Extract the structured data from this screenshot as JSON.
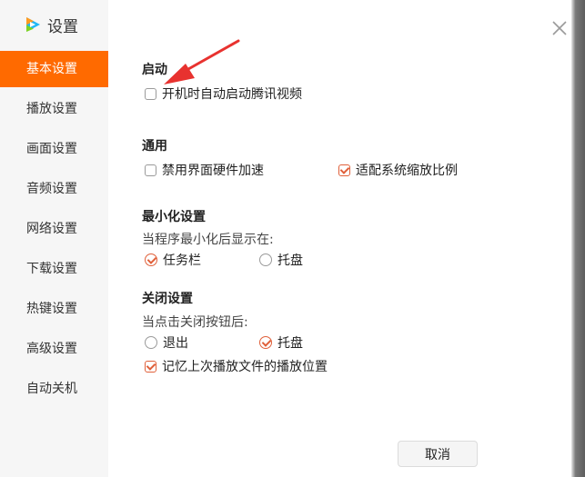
{
  "window": {
    "title": "设置"
  },
  "sidebar": {
    "items": [
      {
        "label": "基本设置",
        "active": true
      },
      {
        "label": "播放设置"
      },
      {
        "label": "画面设置"
      },
      {
        "label": "音频设置"
      },
      {
        "label": "网络设置"
      },
      {
        "label": "下载设置"
      },
      {
        "label": "热键设置"
      },
      {
        "label": "高级设置"
      },
      {
        "label": "自动关机"
      }
    ]
  },
  "startup": {
    "title": "启动",
    "autostart": {
      "label": "开机时自动启动腾讯视频",
      "checked": false
    }
  },
  "general": {
    "title": "通用",
    "disable_hw": {
      "label": "禁用界面硬件加速",
      "checked": false
    },
    "fit_scaling": {
      "label": "适配系统缩放比例",
      "checked": true
    }
  },
  "minimize": {
    "title": "最小化设置",
    "desc": "当程序最小化后显示在:",
    "taskbar": {
      "label": "任务栏",
      "selected": true
    },
    "tray": {
      "label": "托盘",
      "selected": false
    }
  },
  "close": {
    "title": "关闭设置",
    "desc": "当点击关闭按钮后:",
    "exit": {
      "label": "退出",
      "selected": false
    },
    "tray": {
      "label": "托盘",
      "selected": true
    },
    "remember_pos": {
      "label": "记忆上次播放文件的播放位置",
      "checked": true
    }
  },
  "footer": {
    "cancel_label": "取消"
  },
  "colors": {
    "accent": "#ff6a00",
    "check": "#e0603a",
    "annotation_arrow": "#e8322f"
  }
}
